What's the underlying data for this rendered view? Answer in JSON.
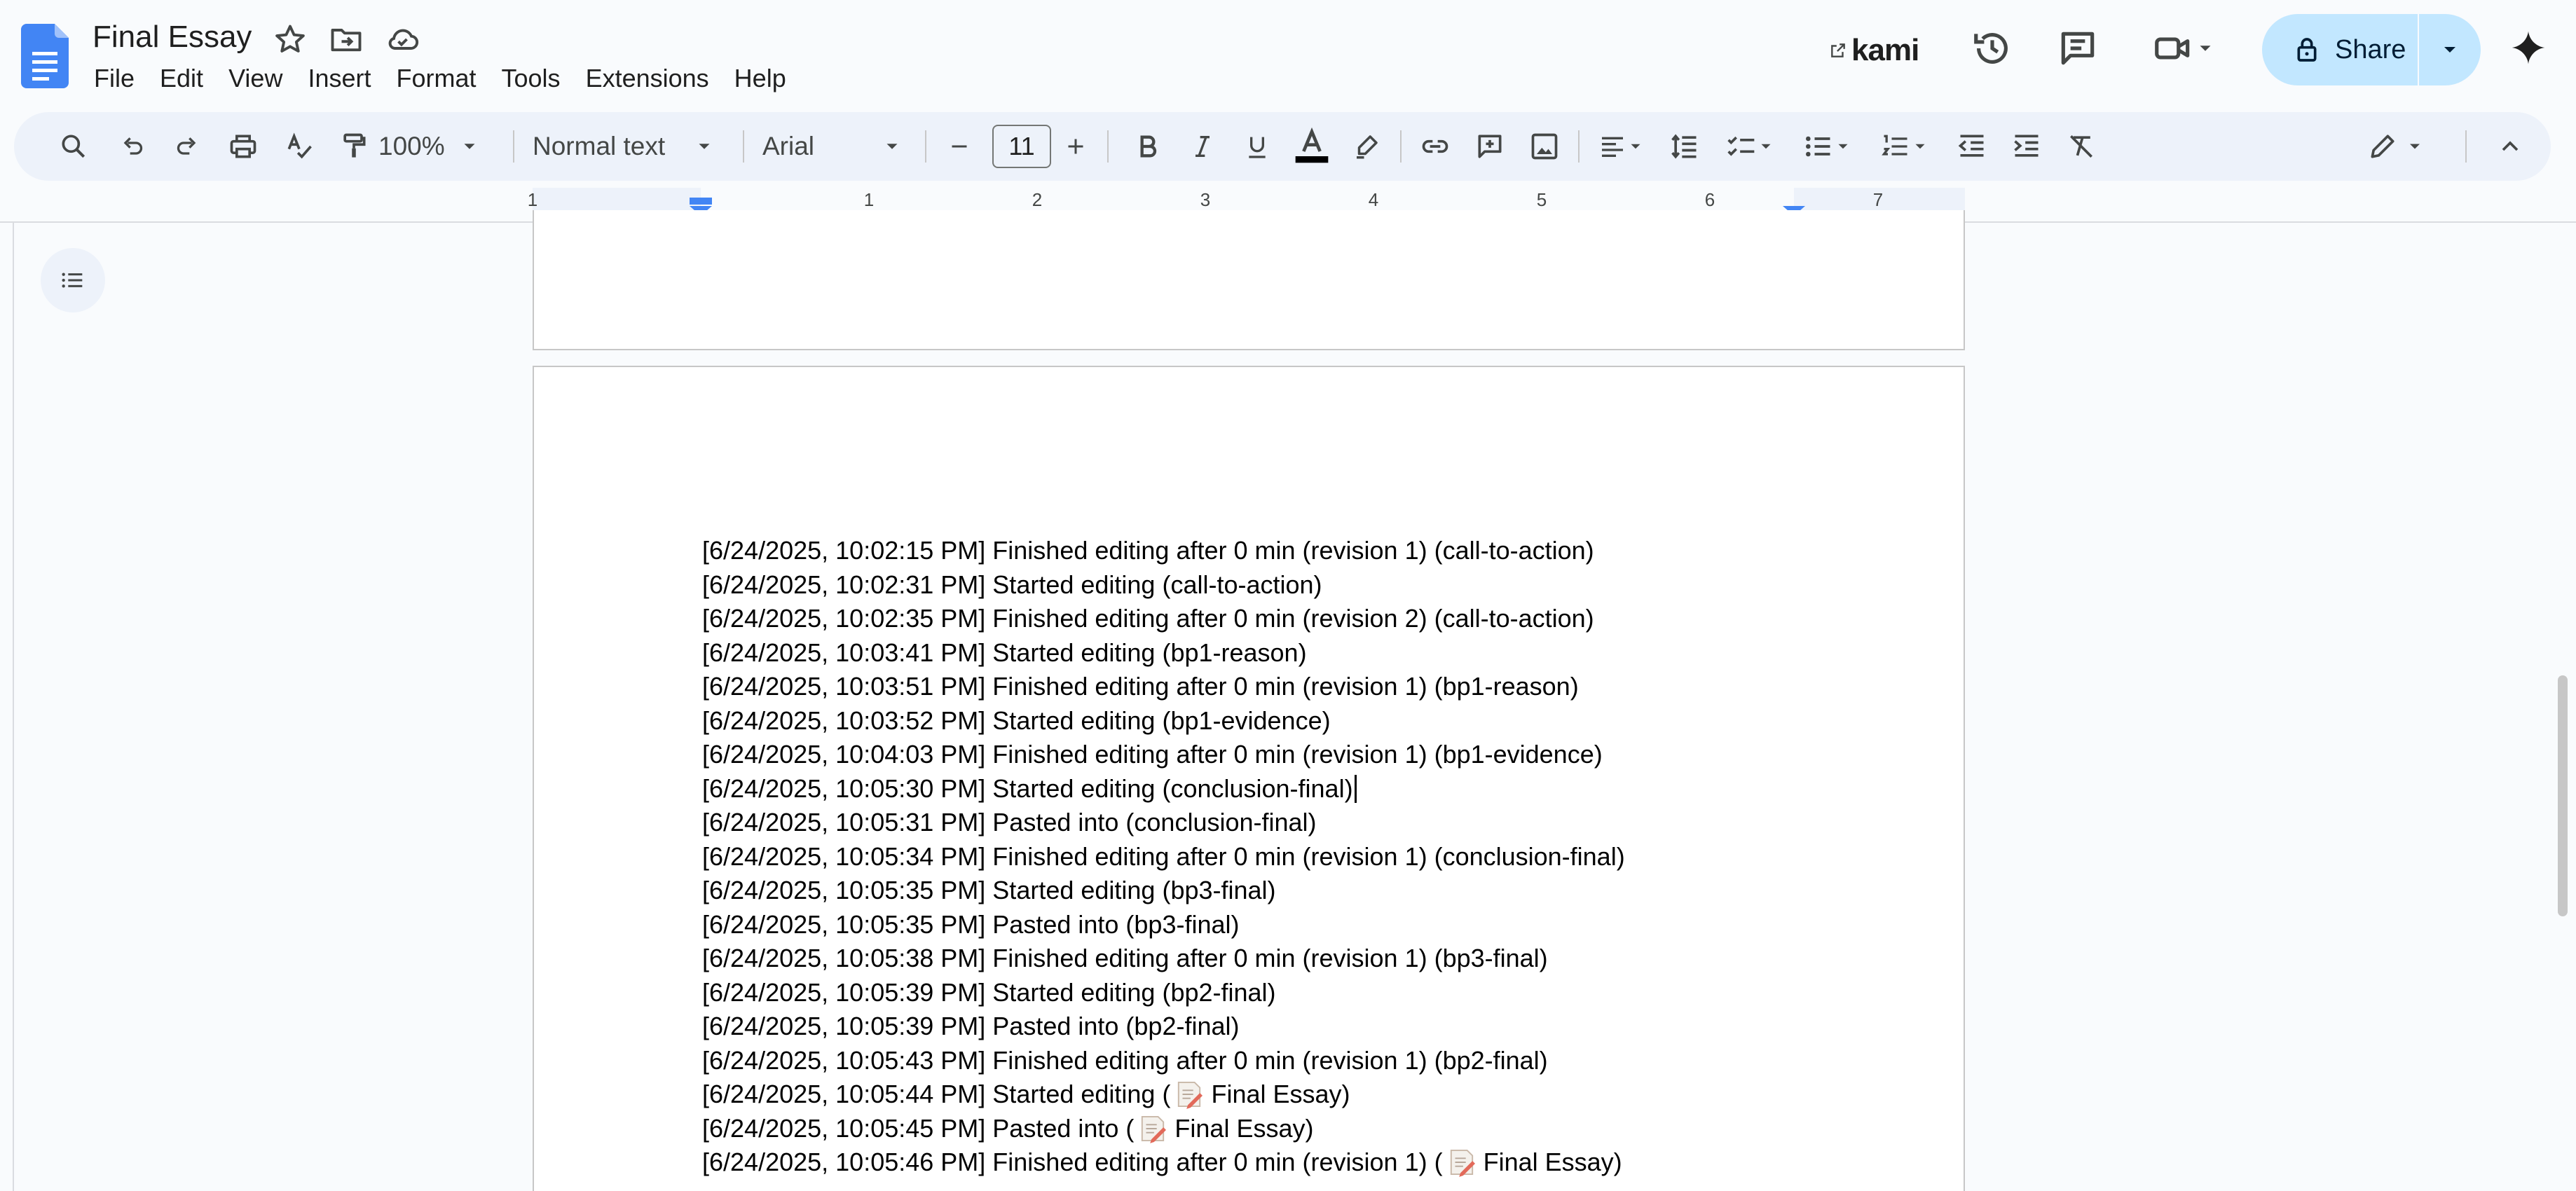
{
  "app": {
    "title": "Final Essay",
    "menu": [
      "File",
      "Edit",
      "View",
      "Insert",
      "Format",
      "Tools",
      "Extensions",
      "Help"
    ],
    "kami_label": "kami",
    "share_label": "Share",
    "icons": {
      "docs_logo": "google-docs-logo",
      "star": "star-icon",
      "move": "move-to-folder-icon",
      "cloud": "cloud-saved-icon",
      "history": "version-history-icon",
      "comments": "comments-icon",
      "meet": "video-call-icon",
      "lock": "lock-icon",
      "gemini": "gemini-sparkle-icon"
    },
    "colors": {
      "share_bg": "#c2e7ff",
      "toolbar_bg": "#edf2fa",
      "docs_blue": "#4285f4",
      "page_bg": "#ffffff",
      "canvas_bg": "#f9fbfd"
    }
  },
  "toolbar": {
    "zoom": "100%",
    "style": "Normal text",
    "font": "Arial",
    "font_size": "11"
  },
  "ruler": {
    "labels": [
      "1",
      "1",
      "2",
      "3",
      "4",
      "5",
      "6",
      "7"
    ]
  },
  "document": {
    "lines": [
      "[6/24/2025, 10:02:15 PM] Finished editing after 0 min (revision 1) (call-to-action)",
      "[6/24/2025, 10:02:31 PM] Started editing (call-to-action)",
      "[6/24/2025, 10:02:35 PM] Finished editing after 0 min (revision 2) (call-to-action)",
      "[6/24/2025, 10:03:41 PM] Started editing (bp1-reason)",
      "[6/24/2025, 10:03:51 PM] Finished editing after 0 min (revision 1) (bp1-reason)",
      "[6/24/2025, 10:03:52 PM] Started editing (bp1-evidence)",
      "[6/24/2025, 10:04:03 PM] Finished editing after 0 min (revision 1) (bp1-evidence)",
      "[6/24/2025, 10:05:30 PM] Started editing (conclusion-final)",
      "[6/24/2025, 10:05:31 PM] Pasted into (conclusion-final)",
      "[6/24/2025, 10:05:34 PM] Finished editing after 0 min (revision 1) (conclusion-final)",
      "[6/24/2025, 10:05:35 PM] Started editing (bp3-final)",
      "[6/24/2025, 10:05:35 PM] Pasted into (bp3-final)",
      "[6/24/2025, 10:05:38 PM] Finished editing after 0 min (revision 1) (bp3-final)",
      "[6/24/2025, 10:05:39 PM] Started editing (bp2-final)",
      "[6/24/2025, 10:05:39 PM] Pasted into (bp2-final)",
      "[6/24/2025, 10:05:43 PM] Finished editing after 0 min (revision 1) (bp2-final)"
    ],
    "memo_lines": [
      {
        "prefix": "[6/24/2025, 10:05:44 PM] Started editing (",
        "suffix": "Final Essay)"
      },
      {
        "prefix": "[6/24/2025, 10:05:45 PM] Pasted into (",
        "suffix": "Final Essay)"
      },
      {
        "prefix": "[6/24/2025, 10:05:46 PM] Finished editing after 0 min (revision 1) (",
        "suffix": "Final Essay)"
      }
    ]
  }
}
